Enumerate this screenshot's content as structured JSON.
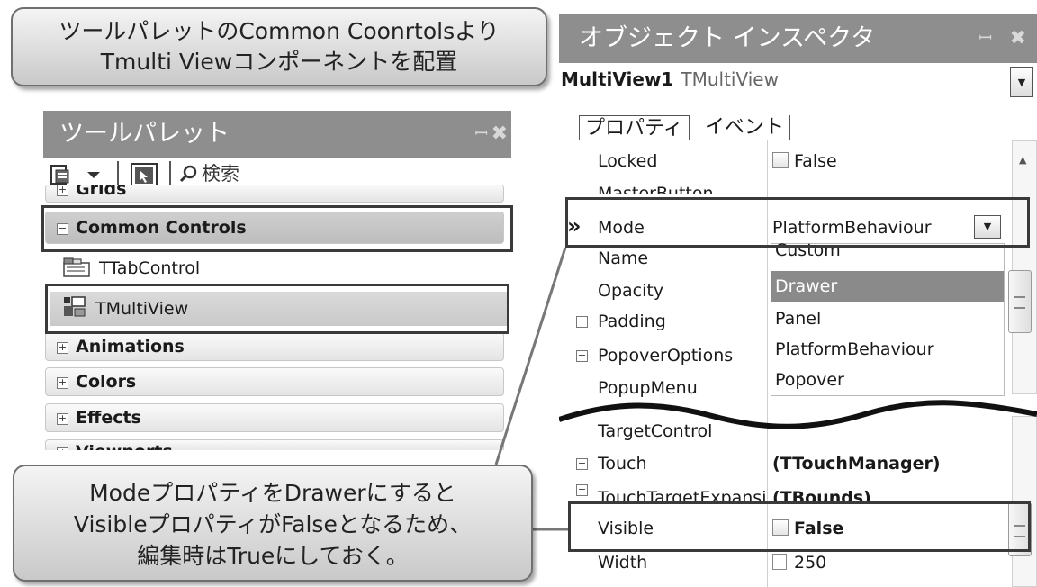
{
  "callouts": {
    "top_line1": "ツールパレットのCommon Coonrtolsより",
    "top_line2": "Tmulti Viewコンポーネントを配置",
    "bottom_line1": "ModeプロパティをDrawerにすると",
    "bottom_line2": "VisibleプロパティがFalseとなるため、",
    "bottom_line3": "編集時はTrueにしておく。"
  },
  "tool_palette": {
    "title": "ツールパレット",
    "pin": "ꟷ",
    "search_label": "検索",
    "partial_category": "Grids",
    "common_controls": "Common Controls",
    "items": [
      "TTabControl",
      "TMultiView"
    ],
    "categories": [
      "Animations",
      "Colors",
      "Effects",
      "Viewports"
    ]
  },
  "object_inspector": {
    "title": "オブジェクト インスペクタ",
    "object_name": "MultiView1",
    "object_type": "TMultiView",
    "tabs": [
      "プロパティ",
      "イベント"
    ],
    "properties_top": [
      {
        "name": "Locked",
        "value": "False"
      },
      {
        "name": "MasterButton",
        "value": ""
      },
      {
        "name": "Mode",
        "value": "PlatformBehaviour"
      },
      {
        "name": "Name",
        "value": ""
      },
      {
        "name": "Opacity",
        "value": ""
      },
      {
        "name": "Padding",
        "value": ""
      },
      {
        "name": "PopoverOptions",
        "value": ""
      },
      {
        "name": "PopupMenu",
        "value": ""
      }
    ],
    "mode_options": [
      "Custom",
      "Drawer",
      "Panel",
      "PlatformBehaviour",
      "Popover"
    ],
    "mode_selected": "Drawer",
    "current_marker": "»",
    "properties_bottom": [
      {
        "name": "TargetControl",
        "value": ""
      },
      {
        "name": "Touch",
        "value": "(TTouchManager)"
      },
      {
        "name": "TouchTargetExpansion",
        "value": "(TBounds)"
      },
      {
        "name": "Visible",
        "value": "False"
      },
      {
        "name": "Width",
        "value": "250"
      }
    ]
  }
}
